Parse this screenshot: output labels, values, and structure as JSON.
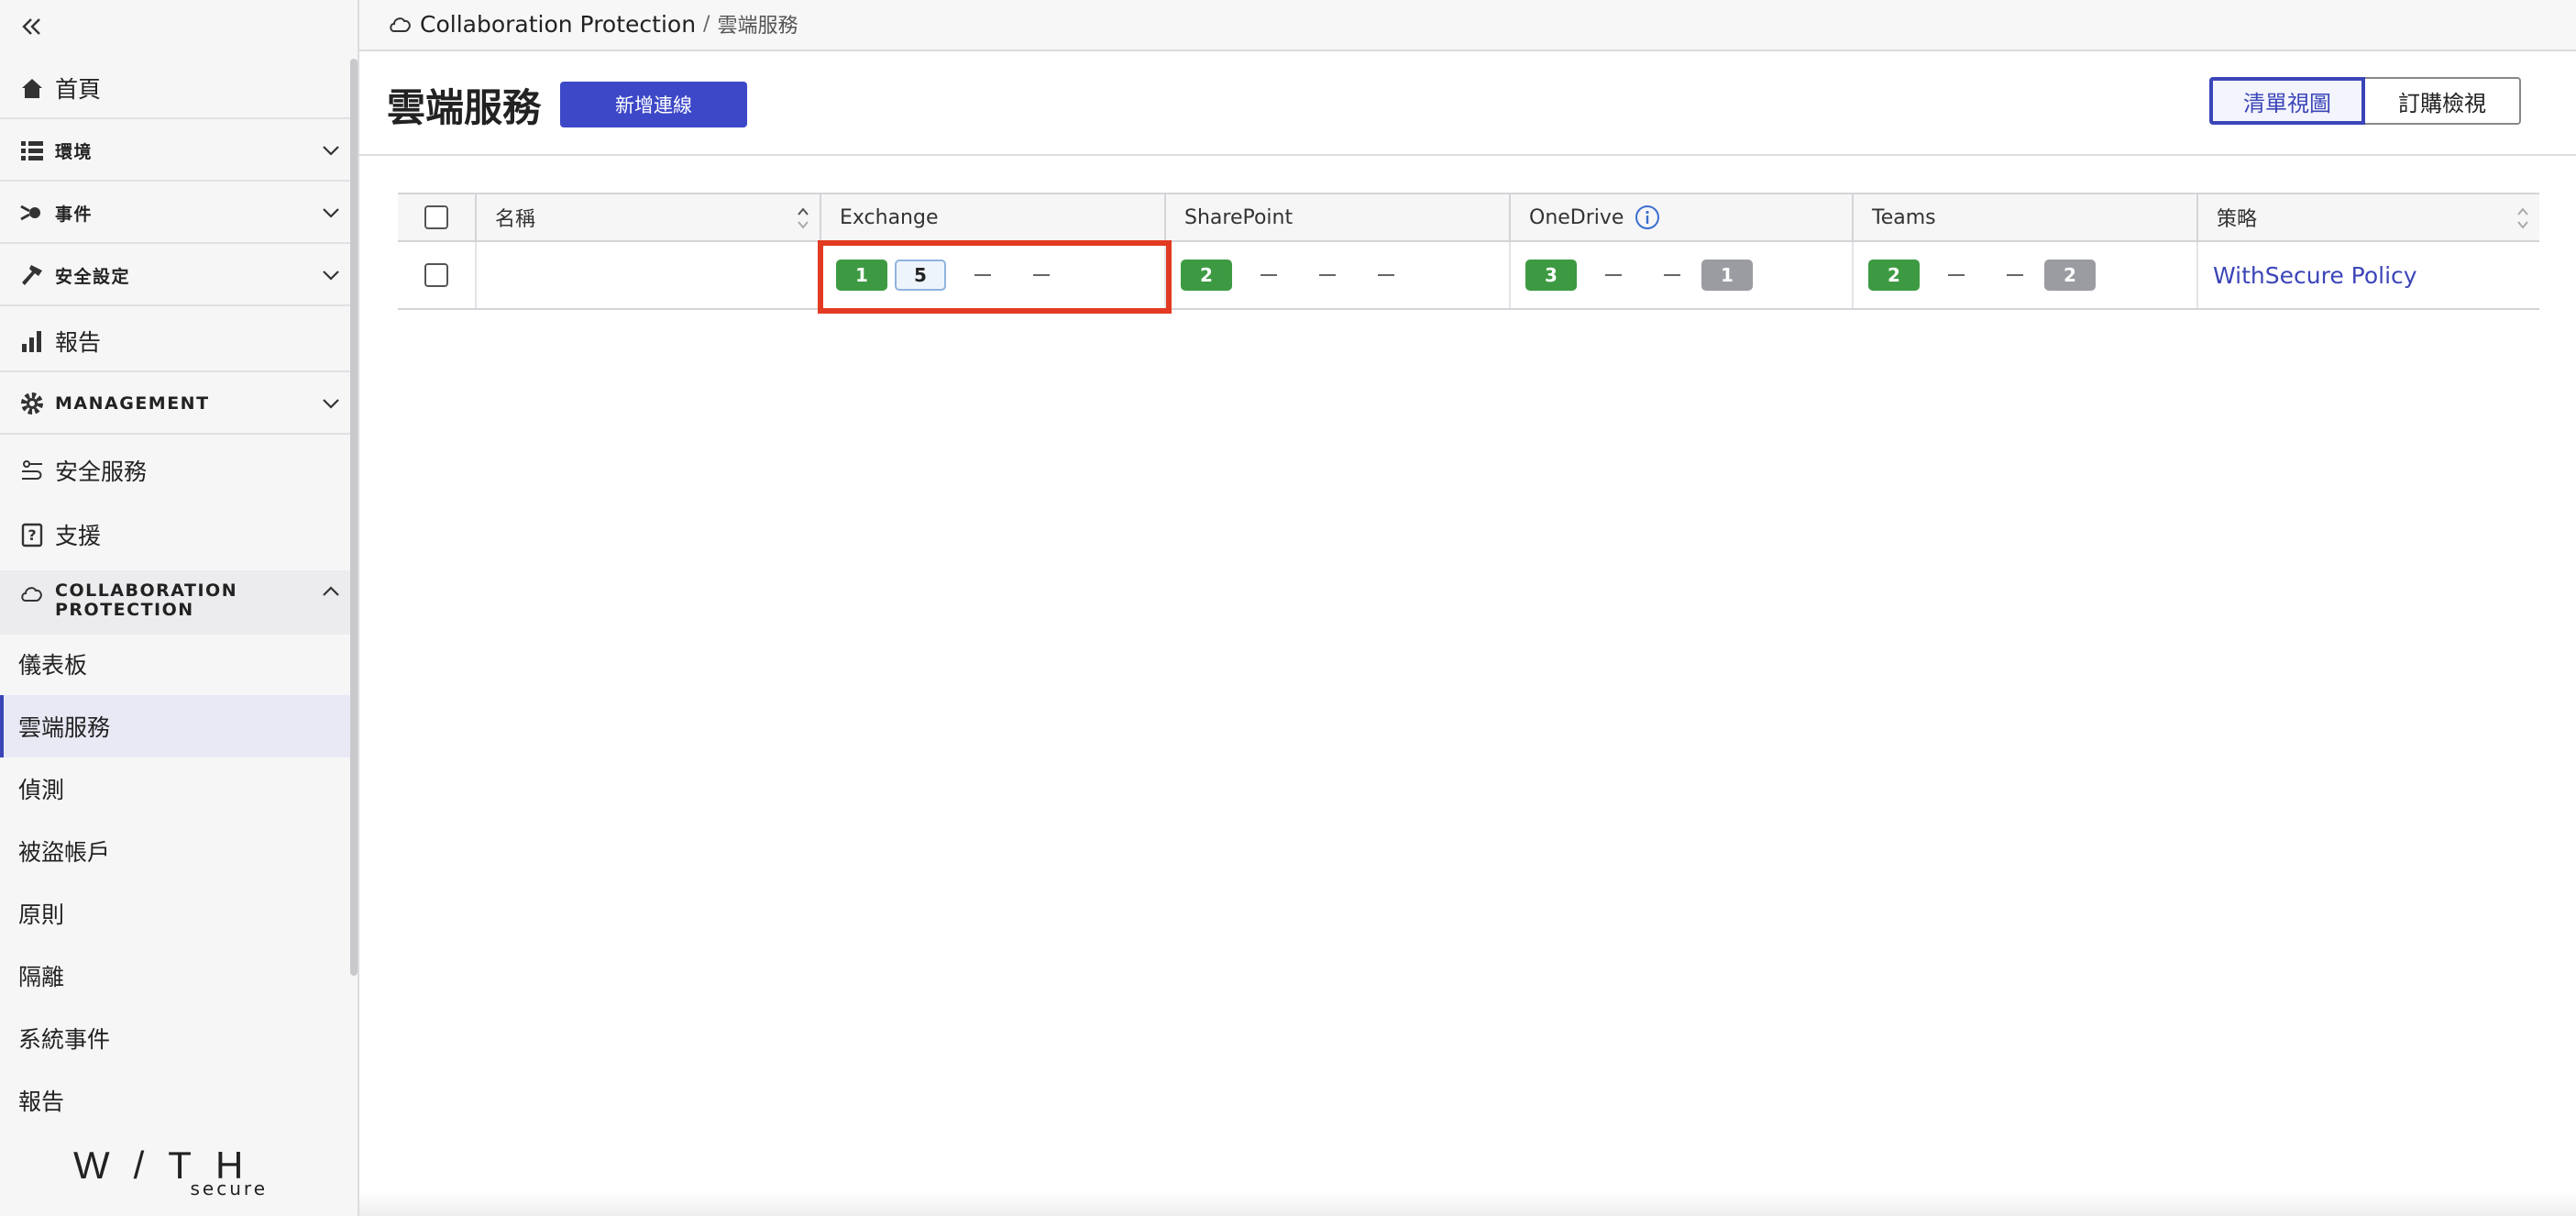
{
  "sidebar": {
    "items": [
      {
        "label": "首頁",
        "icon": "home-icon"
      },
      {
        "label": "環境",
        "icon": "list-icon"
      },
      {
        "label": "事件",
        "icon": "incident-icon"
      },
      {
        "label": "安全設定",
        "icon": "hammer-icon"
      },
      {
        "label": "報告",
        "icon": "bar-chart-icon"
      },
      {
        "label": "MANAGEMENT",
        "icon": "gear-icon"
      },
      {
        "label": "安全服務",
        "icon": "service-icon"
      },
      {
        "label": "支援",
        "icon": "support-icon"
      }
    ],
    "collab_header": "COLLABORATION PROTECTION",
    "sub_items": [
      {
        "label": "儀表板"
      },
      {
        "label": "雲端服務",
        "active": true
      },
      {
        "label": "偵測"
      },
      {
        "label": "被盜帳戶"
      },
      {
        "label": "原則"
      },
      {
        "label": "隔離"
      },
      {
        "label": "系統事件"
      },
      {
        "label": "報告"
      }
    ],
    "logo_mark": "W/TH",
    "logo_sub": "secure"
  },
  "breadcrumb": {
    "parent": "Collaboration Protection",
    "separator": "/",
    "current": "雲端服務"
  },
  "header": {
    "title": "雲端服務",
    "add_button": "新增連線",
    "view_list": "清單視圖",
    "view_subscription": "訂購檢視"
  },
  "table": {
    "columns": [
      "名稱",
      "Exchange",
      "SharePoint",
      "OneDrive",
      "Teams",
      "策略"
    ],
    "row": {
      "name": "",
      "exchange": {
        "green": "1",
        "outlined": "5"
      },
      "sharepoint": {
        "green": "2"
      },
      "onedrive": {
        "green": "3",
        "grey": "1"
      },
      "teams": {
        "green": "2",
        "grey": "2"
      },
      "policy": "WithSecure Policy"
    }
  },
  "colors": {
    "accent": "#3d48c8",
    "active_nav": "#3b45b8",
    "badge_green": "#3d9a42",
    "badge_grey": "#9a9ca1",
    "highlight": "#e23a22"
  }
}
